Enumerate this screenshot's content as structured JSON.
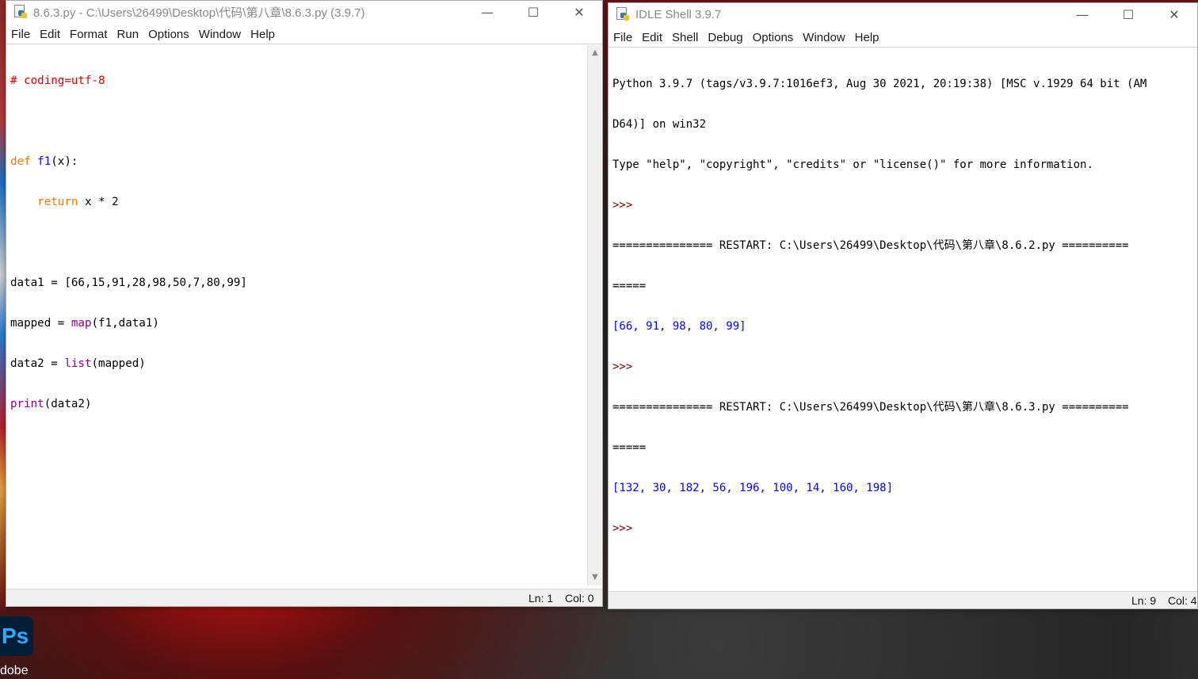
{
  "editor_window": {
    "title": "8.6.3.py - C:\\Users\\26499\\Desktop\\代码\\第八章\\8.6.3.py (3.9.7)",
    "menu": [
      "File",
      "Edit",
      "Format",
      "Run",
      "Options",
      "Window",
      "Help"
    ],
    "code": {
      "line1": "# coding=utf-8",
      "line3_kw": "def",
      "line3_fn": "f1",
      "line3_rest": "(x):",
      "line4_indent": "    ",
      "line4_kw": "return",
      "line4_rest": " x * 2",
      "line6": "data1 = [66,15,91,28,98,50,7,80,99]",
      "line7_a": "mapped = ",
      "line7_bi": "map",
      "line7_b": "(f1,data1)",
      "line8_a": "data2 = ",
      "line8_bi": "list",
      "line8_b": "(mapped)",
      "line9_bi": "print",
      "line9_b": "(data2)"
    },
    "status": {
      "ln": "Ln: 1",
      "col": "Col: 0"
    }
  },
  "shell_window": {
    "title": "IDLE Shell 3.9.7",
    "menu": [
      "File",
      "Edit",
      "Shell",
      "Debug",
      "Options",
      "Window",
      "Help"
    ],
    "output": {
      "banner1": "Python 3.9.7 (tags/v3.9.7:1016ef3, Aug 30 2021, 20:19:38) [MSC v.1929 64 bit (AM",
      "banner2": "D64)] on win32",
      "banner3": "Type \"help\", \"copyright\", \"credits\" or \"license()\" for more information.",
      "prompt": ">>>",
      "restart1a": "=============== RESTART: C:\\Users\\26499\\Desktop\\代码\\第八章\\8.6.2.py ==========",
      "restart1b": "=====",
      "result1": "[66, 91, 98, 80, 99]",
      "restart2a": "=============== RESTART: C:\\Users\\26499\\Desktop\\代码\\第八章\\8.6.3.py ==========",
      "restart2b": "=====",
      "result2": "[132, 30, 182, 56, 196, 100, 14, 160, 198]"
    },
    "status": {
      "ln": "Ln: 9",
      "col": "Col: 4"
    }
  },
  "desktop": {
    "ps_icon": "Ps",
    "ps_label": "dobe"
  },
  "controls": {
    "minimize": "—",
    "maximize": "☐",
    "close": "✕"
  }
}
